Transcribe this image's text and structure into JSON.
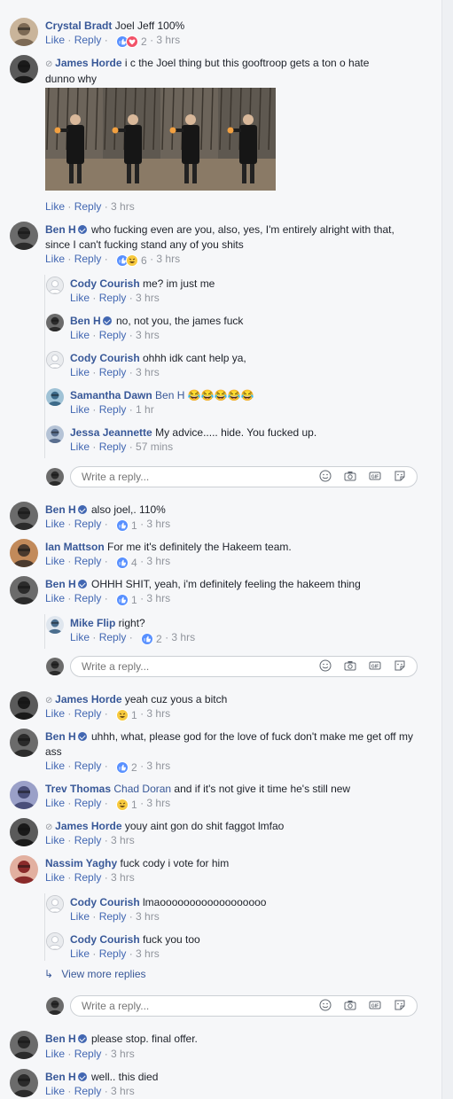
{
  "action_labels": {
    "like": "Like",
    "reply": "Reply"
  },
  "reply_placeholder": "Write a reply...",
  "view_more_replies": "View more replies",
  "comments": [
    {
      "id": "c1",
      "author": "Crystal Bradt",
      "text": "Joel Jeff 100%",
      "reactions": [
        "like",
        "love"
      ],
      "reaction_count": "2",
      "time": "3 hrs"
    },
    {
      "id": "c2",
      "author": "James Horde",
      "text": "i c the Joel thing but this gooftroop gets a ton o hate dunno why",
      "time": "3 hrs"
    },
    {
      "id": "c3",
      "author": "Ben H",
      "text": "who fucking even are you, also, yes, I'm entirely alright with that, since I can't fucking stand any of you shits",
      "reactions": [
        "like",
        "haha"
      ],
      "reaction_count": "6",
      "time": "3 hrs",
      "replies": [
        {
          "author": "Cody Courish",
          "text": "me? im just me",
          "time": "3 hrs"
        },
        {
          "author": "Ben H",
          "text": "no, not you, the james fuck",
          "time": "3 hrs"
        },
        {
          "author": "Cody Courish",
          "text": "ohhh idk cant help ya,",
          "time": "3 hrs"
        },
        {
          "author": "Samantha Dawn",
          "mention": "Ben H",
          "text": "😂😂😂😂😂",
          "time": "1 hr"
        },
        {
          "author": "Jessa Jeannette",
          "text": "My advice..... hide. You fucked up.",
          "time": "57 mins"
        }
      ]
    },
    {
      "id": "c4",
      "author": "Ben H",
      "text": "also joel,. 110%",
      "reactions": [
        "like"
      ],
      "reaction_count": "1",
      "time": "3 hrs"
    },
    {
      "id": "c5",
      "author": "Ian Mattson",
      "text": "For me it's definitely the Hakeem team.",
      "reactions": [
        "like"
      ],
      "reaction_count": "4",
      "time": "3 hrs"
    },
    {
      "id": "c6",
      "author": "Ben H",
      "text": "OHHH SHIT, yeah, i'm definitely feeling the hakeem thing",
      "reactions": [
        "like"
      ],
      "reaction_count": "1",
      "time": "3 hrs",
      "replies": [
        {
          "author": "Mike Flip",
          "text": "right?",
          "reactions": [
            "like"
          ],
          "reaction_count": "2",
          "time": "3 hrs"
        }
      ]
    },
    {
      "id": "c7",
      "author": "James Horde",
      "text": "yeah cuz yous a bitch",
      "reactions": [
        "haha"
      ],
      "reaction_count": "1",
      "time": "3 hrs"
    },
    {
      "id": "c8",
      "author": "Ben H",
      "text": "uhhh, what, please god for the love of fuck don't make me get off my ass",
      "reactions": [
        "like"
      ],
      "reaction_count": "2",
      "time": "3 hrs"
    },
    {
      "id": "c9",
      "author": "Trev Thomas",
      "mention": "Chad Doran",
      "text": "and if it's not give it time he's still new",
      "reactions": [
        "haha"
      ],
      "reaction_count": "1",
      "time": "3 hrs"
    },
    {
      "id": "c10",
      "author": "James Horde",
      "text": "youy aint gon do shit faggot lmfao",
      "time": "3 hrs"
    },
    {
      "id": "c11",
      "author": "Nassim Yaghy",
      "text": "fuck cody i vote for him",
      "time": "3 hrs",
      "replies": [
        {
          "author": "Cody Courish",
          "text": "lmaoooooooooooooooooo",
          "time": "3 hrs"
        },
        {
          "author": "Cody Courish",
          "text": "fuck you too",
          "time": "3 hrs"
        }
      ]
    },
    {
      "id": "c12",
      "author": "Ben H",
      "text": "please stop. final offer.",
      "time": "3 hrs"
    },
    {
      "id": "c13",
      "author": "Ben H",
      "text": "well.. this died",
      "time": "3 hrs"
    }
  ]
}
